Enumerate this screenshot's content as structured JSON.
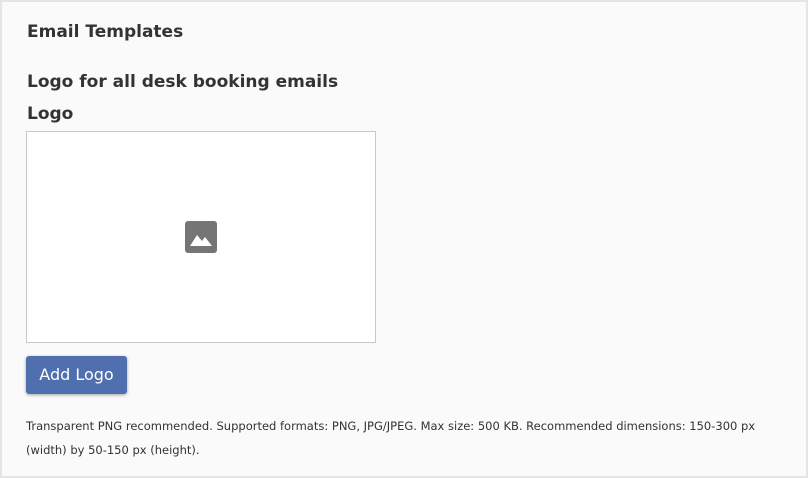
{
  "email_templates": {
    "section_title": "Email Templates",
    "subsection_title": "Logo for all desk booking emails",
    "logo": {
      "label": "Logo",
      "placeholder_icon": "image-icon",
      "add_button_label": "Add Logo",
      "help_text": "Transparent PNG recommended. Supported formats: PNG, JPG/JPEG. Max size: 500 KB. Recommended dimensions: 150-300 px (width) by 50-150 px (height)."
    }
  },
  "colors": {
    "accent": "#4f6fae",
    "panel_background": "#fafafa",
    "text": "#333333",
    "icon": "#757575"
  }
}
